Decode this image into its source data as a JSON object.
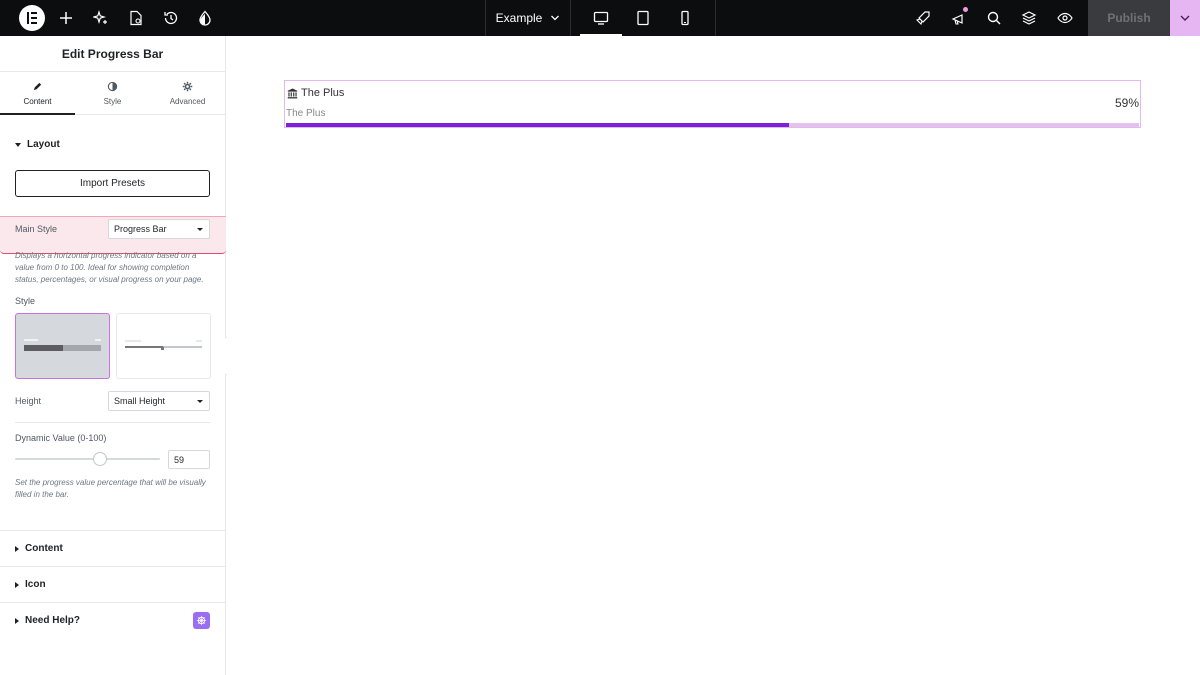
{
  "topbar": {
    "page_name": "Example",
    "publish_label": "Publish"
  },
  "panel": {
    "title": "Edit Progress Bar",
    "tabs": [
      {
        "label": "Content",
        "icon": "pencil-icon",
        "active": true
      },
      {
        "label": "Style",
        "icon": "contrast-icon",
        "active": false
      },
      {
        "label": "Advanced",
        "icon": "gear-icon",
        "active": false
      }
    ],
    "layout": {
      "section_title": "Layout",
      "import_label": "Import Presets",
      "main_style_label": "Main Style",
      "main_style_value": "Progress Bar",
      "main_style_desc": "Displays a horizontal progress indicator based on a value from 0 to 100. Ideal for showing completion status, percentages, or visual progress on your page.",
      "style_label": "Style",
      "height_label": "Height",
      "height_value": "Small Height",
      "dynamic_label": "Dynamic Value (0-100)",
      "dynamic_value": "59",
      "dynamic_desc": "Set the progress value percentage that will be visually filled in the bar."
    },
    "sections": [
      {
        "label": "Content"
      },
      {
        "label": "Icon"
      },
      {
        "label": "Need Help?"
      }
    ]
  },
  "widget": {
    "title": "The Plus",
    "subtitle": "The Plus",
    "number": "59%",
    "progress": 59,
    "fill_color": "#7d22d6",
    "track_color": "#e0c4ec"
  }
}
